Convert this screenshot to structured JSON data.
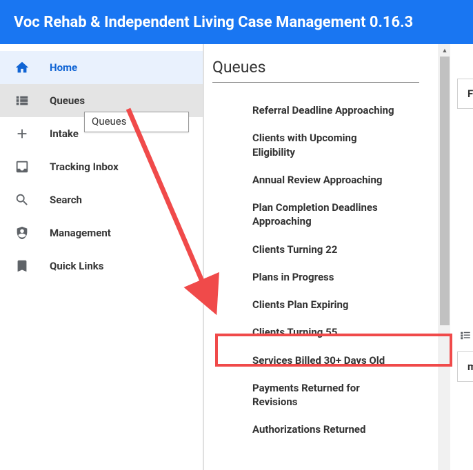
{
  "header": {
    "title": "Voc Rehab & Independent Living Case Management 0.16.3"
  },
  "sidebar": {
    "items": [
      {
        "label": "Home"
      },
      {
        "label": "Queues"
      },
      {
        "label": "Intake"
      },
      {
        "label": "Tracking Inbox"
      },
      {
        "label": "Search"
      },
      {
        "label": "Management"
      },
      {
        "label": "Quick Links"
      }
    ]
  },
  "tooltip": {
    "text": "Queues"
  },
  "submenu": {
    "title": "Queues",
    "items": [
      {
        "label": "Referral Deadline Approaching"
      },
      {
        "label": "Clients with Upcoming Eligibility"
      },
      {
        "label": "Annual Review Approaching"
      },
      {
        "label": "Plan Completion Deadlines Approaching"
      },
      {
        "label": "Clients Turning 22"
      },
      {
        "label": "Plans in Progress"
      },
      {
        "label": "Clients Plan Expiring"
      },
      {
        "label": "Clients Turning 55"
      },
      {
        "label": "Services Billed 30+ Days Old"
      },
      {
        "label": "Payments Returned for Revisions"
      },
      {
        "label": "Authorizations Returned"
      }
    ]
  },
  "right": {
    "col1": "Fisca",
    "col2": "me"
  }
}
